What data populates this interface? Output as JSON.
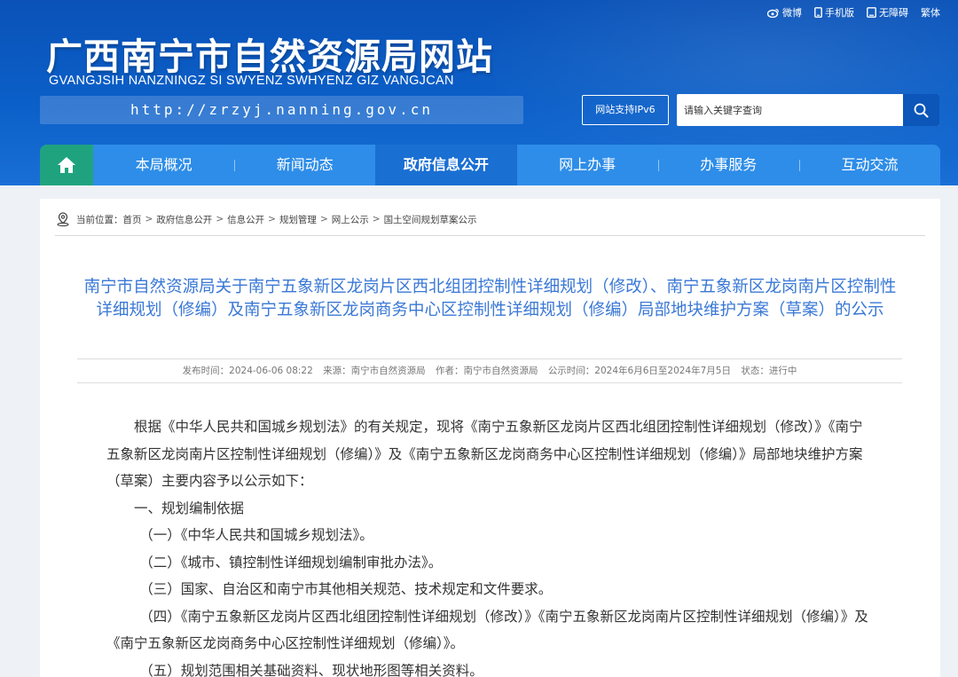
{
  "top_links": [
    {
      "label": "微博",
      "icon": "weibo-icon"
    },
    {
      "label": "手机版",
      "icon": "mobile-icon"
    },
    {
      "label": "无障碍",
      "icon": "accessibility-icon"
    },
    {
      "label": "繁体",
      "icon": ""
    }
  ],
  "header": {
    "title": "广西南宁市自然资源局网站",
    "subtitle": "GVANGJSIH NANZNINGZ SI SWYENZ SWHYENZ GIZ VANGJCAN",
    "url": "http://zrzyj.nanning.gov.cn",
    "ipv6": "网站支持IPv6",
    "search_placeholder": "请输入关键字查询"
  },
  "nav": {
    "items": [
      "本局概况",
      "新闻动态",
      "政府信息公开",
      "网上办事",
      "办事服务",
      "互动交流"
    ],
    "active": "政府信息公开"
  },
  "breadcrumb": {
    "prefix": "当前位置：",
    "items": [
      "首页",
      "政府信息公开",
      "信息公开",
      "规划管理",
      "网上公示",
      "国土空间规划草案公示"
    ]
  },
  "article": {
    "title": "南宁市自然资源局关于南宁五象新区龙岗片区西北组团控制性详细规划（修改）、南宁五象新区龙岗南片区控制性详细规划（修编）及南宁五象新区龙岗商务中心区控制性详细规划（修编）局部地块维护方案（草案）的公示",
    "meta": {
      "publish": "发布时间：2024-06-06 08:22",
      "source": "来源：南宁市自然资源局",
      "author": "作者：南宁市自然资源局",
      "period": "公示时间：2024年6月6日至2024年7月5日",
      "status": "状态：进行中"
    },
    "intro": "根据《中华人民共和国城乡规划法》的有关规定，现将《南宁五象新区龙岗片区西北组团控制性详细规划（修改）》《南宁五象新区龙岗南片区控制性详细规划（修编）》及《南宁五象新区龙岗商务中心区控制性详细规划（修编）》局部地块维护方案（草案）主要内容予以公示如下：",
    "section1": "一、规划编制依据",
    "items": [
      "（一）《中华人民共和国城乡规划法》。",
      "（二）《城市、镇控制性详细规划编制审批办法》。",
      "（三）国家、自治区和南宁市其他相关规范、技术规定和文件要求。",
      "（四）《南宁五象新区龙岗片区西北组团控制性详细规划（修改）》《南宁五象新区龙岗南片区控制性详细规划（修编）》及《南宁五象新区龙岗商务中心区控制性详细规划（修编）》。",
      "（五）规划范围相关基础资料、现状地形图等相关资料。"
    ]
  }
}
